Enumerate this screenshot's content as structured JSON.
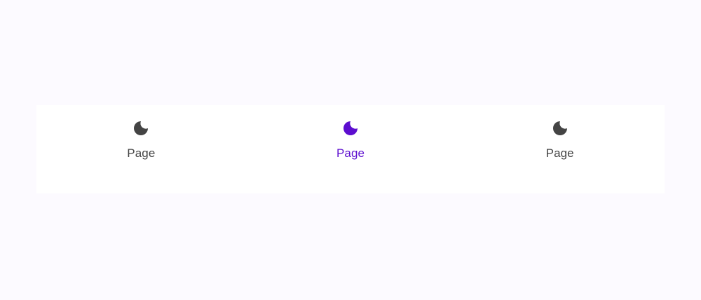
{
  "colors": {
    "page_background": "#fcfaff",
    "nav_background": "#ffffff",
    "inactive": "#444444",
    "active": "#5c0dcf"
  },
  "bottom_nav": {
    "items": [
      {
        "label": "Page",
        "icon": "moon-icon",
        "active": false
      },
      {
        "label": "Page",
        "icon": "moon-icon",
        "active": true
      },
      {
        "label": "Page",
        "icon": "moon-icon",
        "active": false
      }
    ]
  }
}
